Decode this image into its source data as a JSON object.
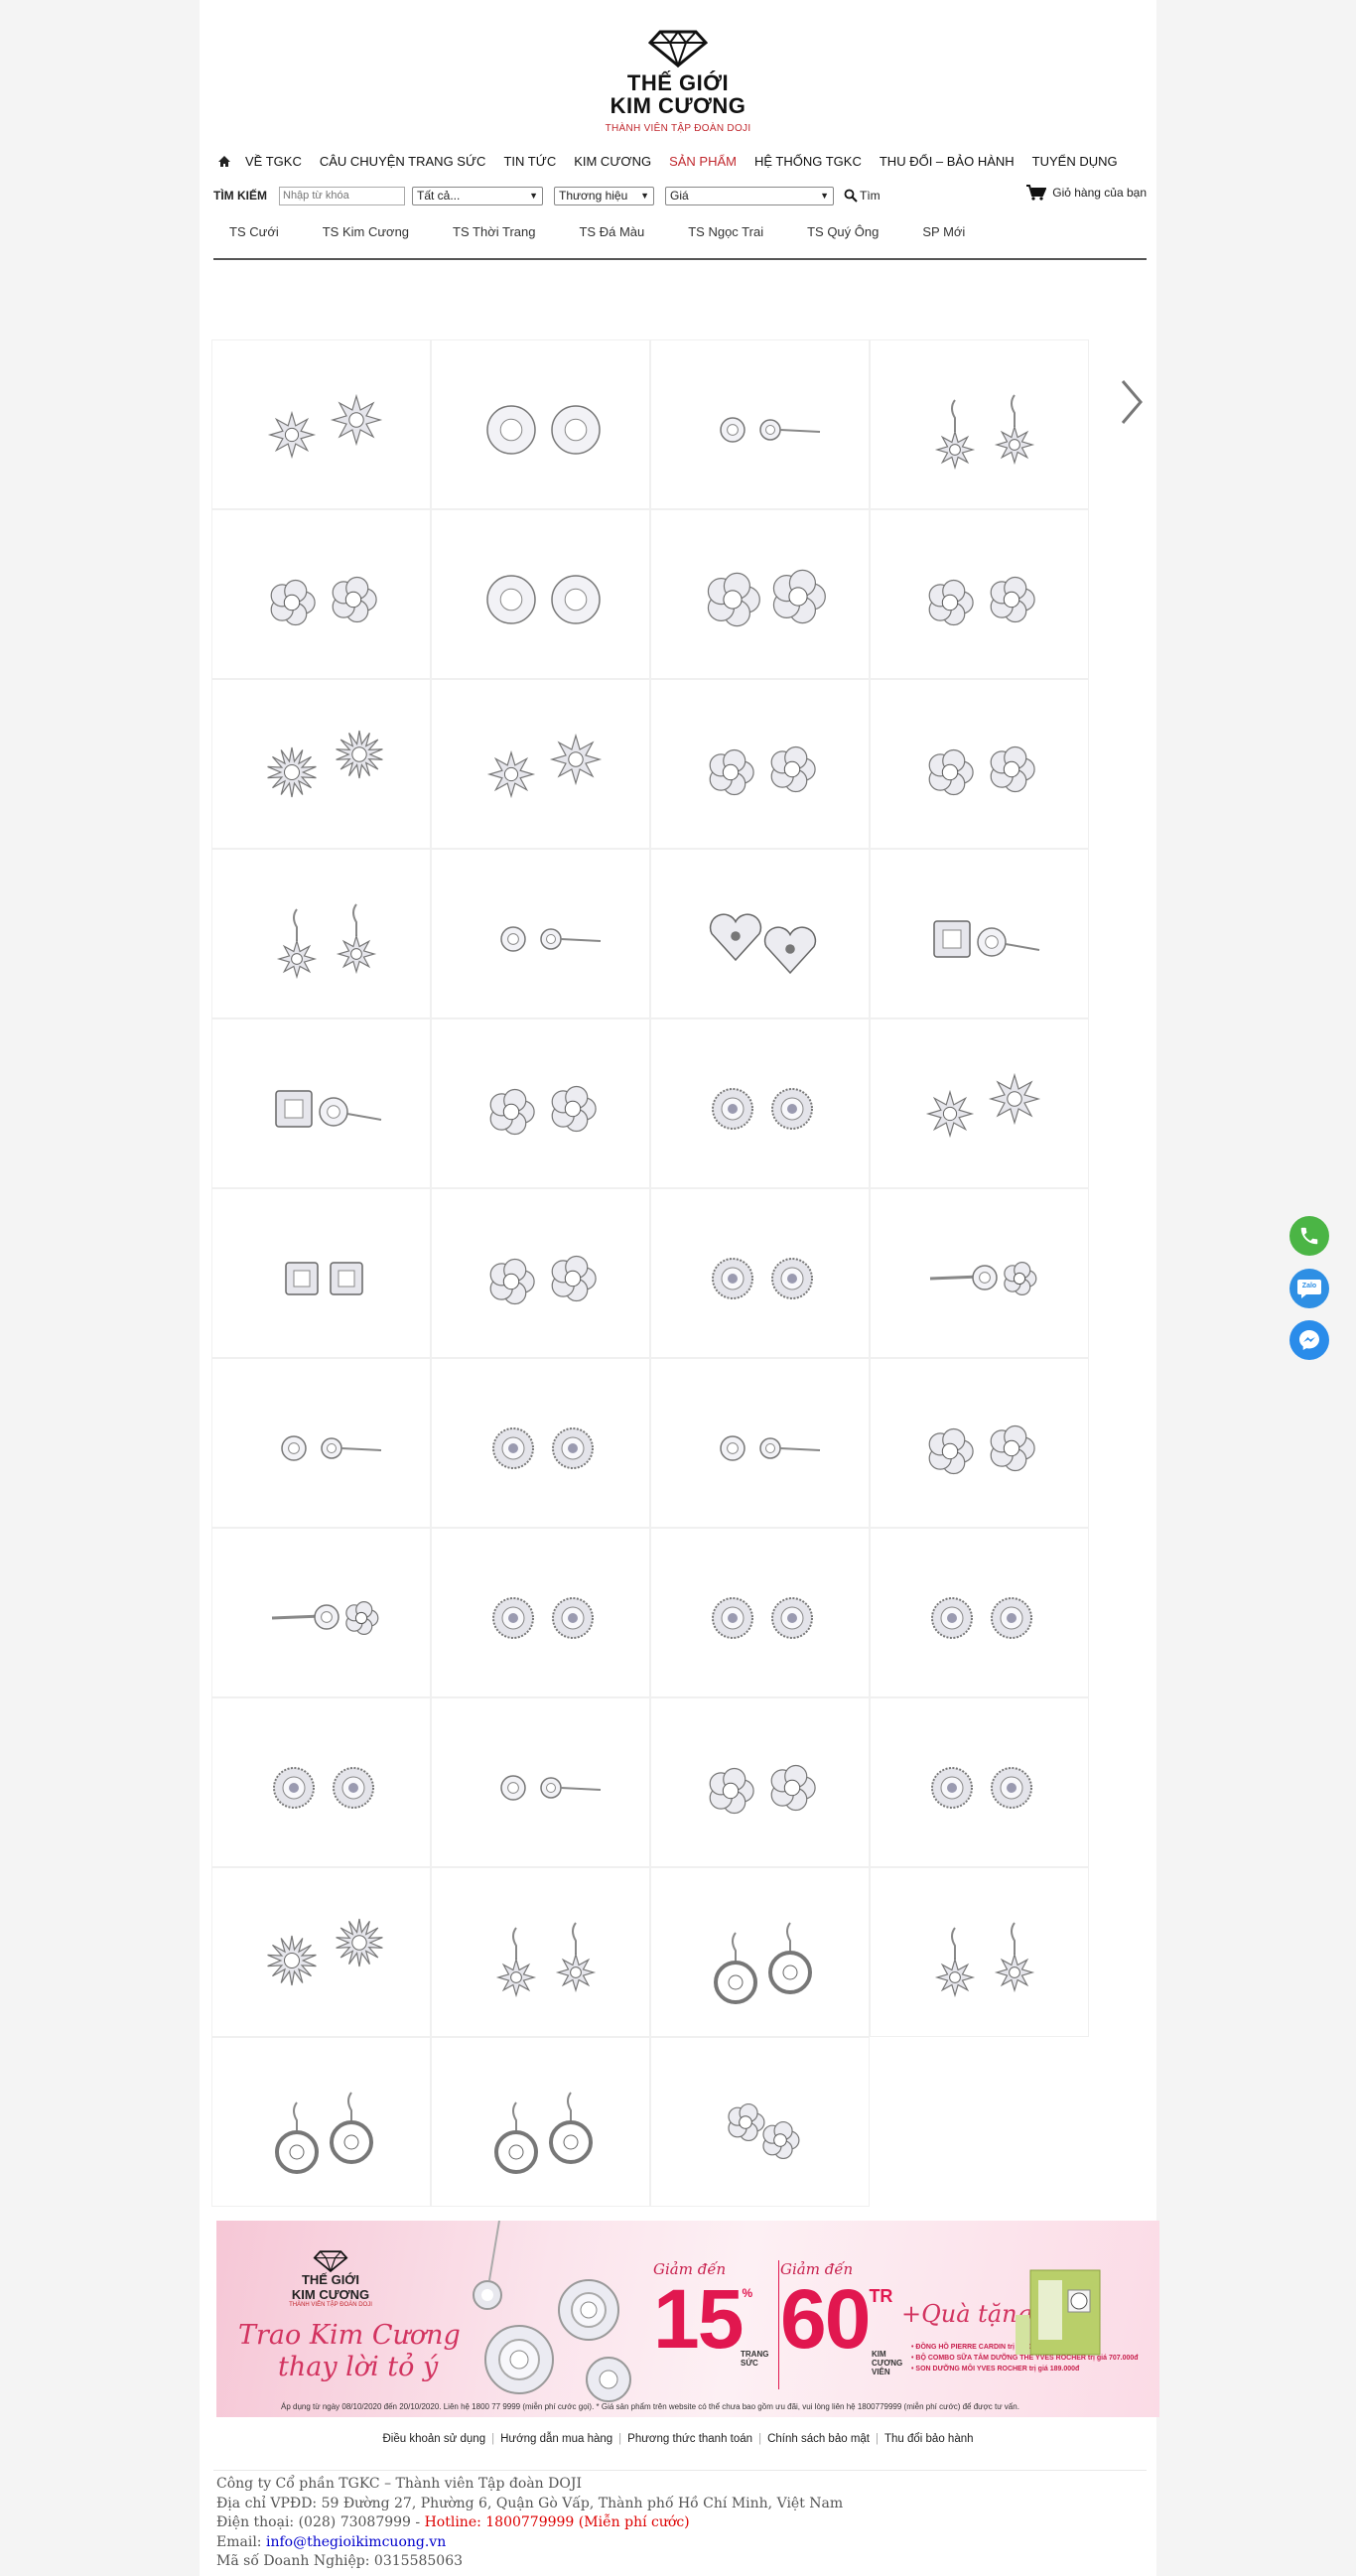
{
  "logo": {
    "line1": "THẾ GIỚI",
    "line2": "KIM CƯƠNG",
    "tagline": "THÀNH VIÊN TẬP ĐOÀN DOJI"
  },
  "nav": {
    "items": [
      {
        "label": "VỀ TGKC"
      },
      {
        "label": "CÂU CHUYỆN TRANG SỨC"
      },
      {
        "label": "TIN TỨC"
      },
      {
        "label": "KIM CƯƠNG"
      },
      {
        "label": "SẢN PHẨM",
        "active": true
      },
      {
        "label": "HỆ THỐNG TGKC"
      },
      {
        "label": "THU ĐỔI – BẢO HÀNH"
      },
      {
        "label": "TUYỂN DỤNG"
      }
    ]
  },
  "search": {
    "label": "TÌM KIẾM",
    "placeholder": "Nhập từ khóa",
    "category_value": "Tất cả...",
    "brand_value": "Thương hiệu",
    "price_value": "Giá",
    "button_label": "Tìm",
    "cart_label": "Giỏ hàng của bạn"
  },
  "categories": [
    "TS Cưới",
    "TS Kim Cương",
    "TS Thời Trang",
    "TS Đá Màu",
    "TS Ngọc Trai",
    "TS Quý Ông",
    "SP Mới"
  ],
  "products": {
    "count": 43,
    "styles": [
      "star",
      "swirl",
      "stud-side",
      "drop-star",
      "flower",
      "swirl",
      "lotus",
      "flower",
      "sun",
      "star",
      "flower",
      "flower",
      "drop-star",
      "stud-side",
      "heart",
      "square-side",
      "square-side",
      "halo-flower",
      "halo",
      "star",
      "square",
      "flower",
      "halo",
      "bar",
      "stud-side",
      "halo",
      "stud-side",
      "flower",
      "bar",
      "halo",
      "halo",
      "halo",
      "halo",
      "stud-side",
      "flower",
      "halo",
      "sun",
      "drop-star",
      "swirl-drop",
      "drop-star",
      "swirl-drop",
      "swirl-drop",
      "petal"
    ]
  },
  "banner": {
    "logo_line1": "THẾ GIỚI",
    "logo_line2": "KIM CƯƠNG",
    "logo_tagline": "THÀNH VIÊN TẬP ĐOÀN DOJI",
    "slogan_line1": "Trao Kim Cương",
    "slogan_line2": "thay lời tỏ ý",
    "discount1_prefix": "Giảm đến",
    "discount1_value": "15",
    "discount1_unit": "%",
    "discount1_sub": "TRANG SỨC",
    "discount2_prefix": "Giảm đến",
    "discount2_value": "60",
    "discount2_unit": "TR",
    "discount2_sub": "KIM CƯƠNG VIÊN",
    "gift_label": "+Quà tặng",
    "gift_items": [
      "• ĐỒNG HỒ PIERRE CARDIN trị giá 3.300.000đ",
      "• BỘ COMBO SỮA TẮM DƯỠNG THỂ YVES ROCHER trị giá 707.000đ",
      "• SON DƯỠNG MÔI YVES ROCHER trị giá 189.000đ"
    ],
    "note": "Áp dụng từ ngày 08/10/2020 đến 20/10/2020. Liên hệ 1800 77 9999 (miễn phí cước gọi). * Giá sản phẩm trên website có thể chưa bao gồm ưu đãi, vui lòng liên hệ 1800779999 (miễn phí cước) để được tư vấn."
  },
  "footer": {
    "links": [
      "Điều khoản sử dụng",
      "Hướng dẫn mua hàng",
      "Phương thức thanh toán",
      "Chính sách bảo mật",
      "Thu đổi bảo hành"
    ],
    "company": "Công ty Cổ phần TGKC – Thành viên Tập đoàn DOJI",
    "address": "Địa chỉ VPĐD: 59 Đường 27, Phường 6, Quận Gò Vấp, Thành phố Hồ Chí Minh, Việt Nam",
    "phone_label": "Điện thoại: (028) 73087999 - ",
    "hotline": "Hotline: 1800779999 (Miễn phí cước)",
    "email_label": "Email: ",
    "email": "info@thegioikimcuong.vn",
    "tax": "Mã số Doanh Nghiệp: 0315585063"
  },
  "floating": {
    "zalo_label": "Zalo"
  },
  "colors": {
    "accent": "#c0272d",
    "banner_pink": "#e1174f",
    "phone_green": "#4bb545",
    "zalo_blue": "#2e8fe4"
  }
}
